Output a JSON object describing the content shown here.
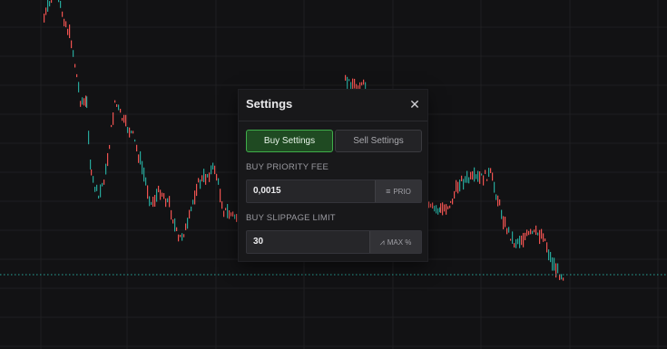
{
  "modal": {
    "title": "Settings",
    "close_icon": "close-icon"
  },
  "tabs": [
    {
      "label": "Buy Settings",
      "active": true
    },
    {
      "label": "Sell Settings",
      "active": false
    }
  ],
  "priority_fee": {
    "label": "BUY PRIORITY FEE",
    "value": "0,0015",
    "suffix_icon": "list-icon",
    "suffix_label": "PRIO"
  },
  "slippage": {
    "label": "BUY SLIPPAGE LIMIT",
    "value": "30",
    "suffix_icon": "slippage-icon",
    "suffix_label": "MAX %"
  },
  "colors": {
    "background": "#121214",
    "grid": "#1f1f22",
    "candle_up": "#26a69a",
    "candle_down": "#ef5350",
    "price_line": "#26a69a",
    "accent": "#3fae4a"
  }
}
